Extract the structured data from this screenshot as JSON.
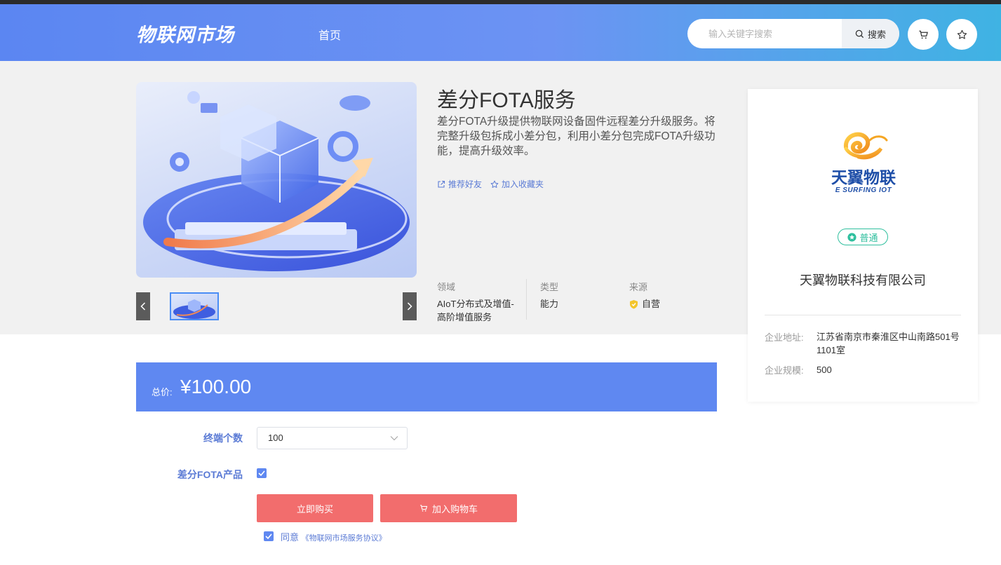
{
  "header": {
    "logo": "物联网市场",
    "nav_home": "首页",
    "search_placeholder": "输入关键字搜索",
    "search_button": "搜索"
  },
  "product": {
    "title": "差分FOTA服务",
    "description": "差分FOTA升级提供物联网设备固件远程差分升级服务。将完整升级包拆成小差分包，利用小差分包完成FOTA升级功能，提高升级效率。",
    "recommend": "推荐好友",
    "favorite": "加入收藏夹",
    "meta": {
      "domain_label": "领域",
      "domain_value": "AIoT分布式及增值-高阶增值服务",
      "type_label": "类型",
      "type_value": "能力",
      "source_label": "来源",
      "source_value": "自营"
    }
  },
  "vendor": {
    "logo_cn": "天翼物联",
    "logo_en": "E SURFING IOT",
    "badge": "普通",
    "company": "天翼物联科技有限公司",
    "address_label": "企业地址:",
    "address_value": "江苏省南京市秦淮区中山南路501号1101室",
    "scale_label": "企业规模:",
    "scale_value": "500"
  },
  "order": {
    "total_label": "总价:",
    "total_amount": "¥100.00",
    "terminal_label": "终端个数",
    "terminal_value": "100",
    "fota_label": "差分FOTA产品",
    "buy_now": "立即购买",
    "add_cart": "加入购物车",
    "agree_text": "同意",
    "agree_link": "《物联网市场服务协议》"
  },
  "colors": {
    "primary": "#5f88f1",
    "buy": "#f26d6d",
    "badge": "#2fbf9e"
  }
}
